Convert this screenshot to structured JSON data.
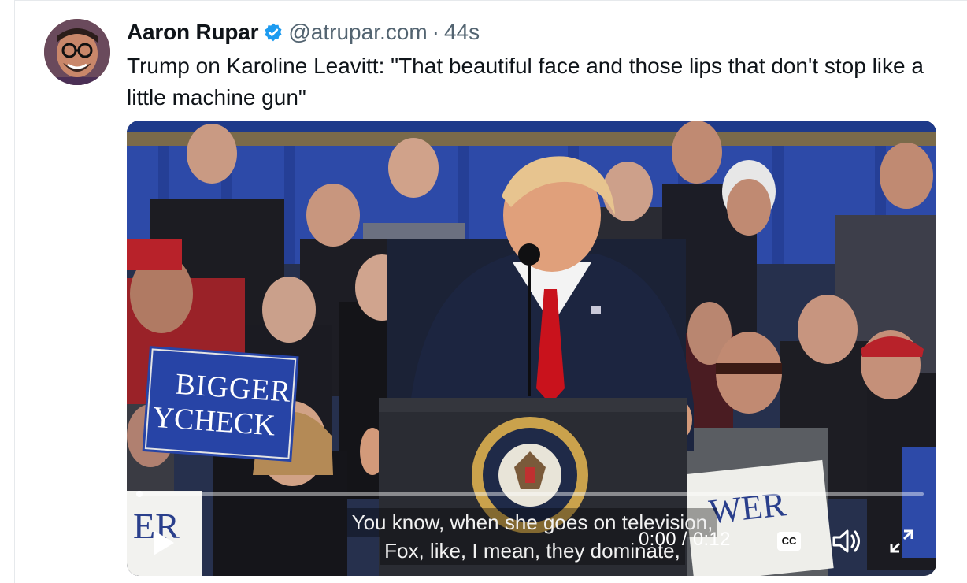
{
  "post": {
    "author_name": "Aaron Rupar",
    "verified": true,
    "handle": "@atrupar.com",
    "separator": "·",
    "timestamp": "44s",
    "text": "Trump on Karoline Leavitt: \"That beautiful face and those lips that don't stop like a little machine gun\""
  },
  "video": {
    "captions": [
      "You know, when she goes on television,",
      "Fox, like, I mean, they dominate,"
    ],
    "time_display": "0:00 / 0:12",
    "progress_fraction": 0.0,
    "cc_label": "CC",
    "sign_left_text": "BIGGER PAYCHECK",
    "icons": {
      "play": "play-icon",
      "cc": "closed-captions-icon",
      "volume": "volume-icon",
      "fullscreen": "fullscreen-icon"
    }
  },
  "colors": {
    "text_primary": "#0f1419",
    "text_secondary": "#536471",
    "verified_blue": "#1d9bf0",
    "tie_red": "#d0161f"
  }
}
